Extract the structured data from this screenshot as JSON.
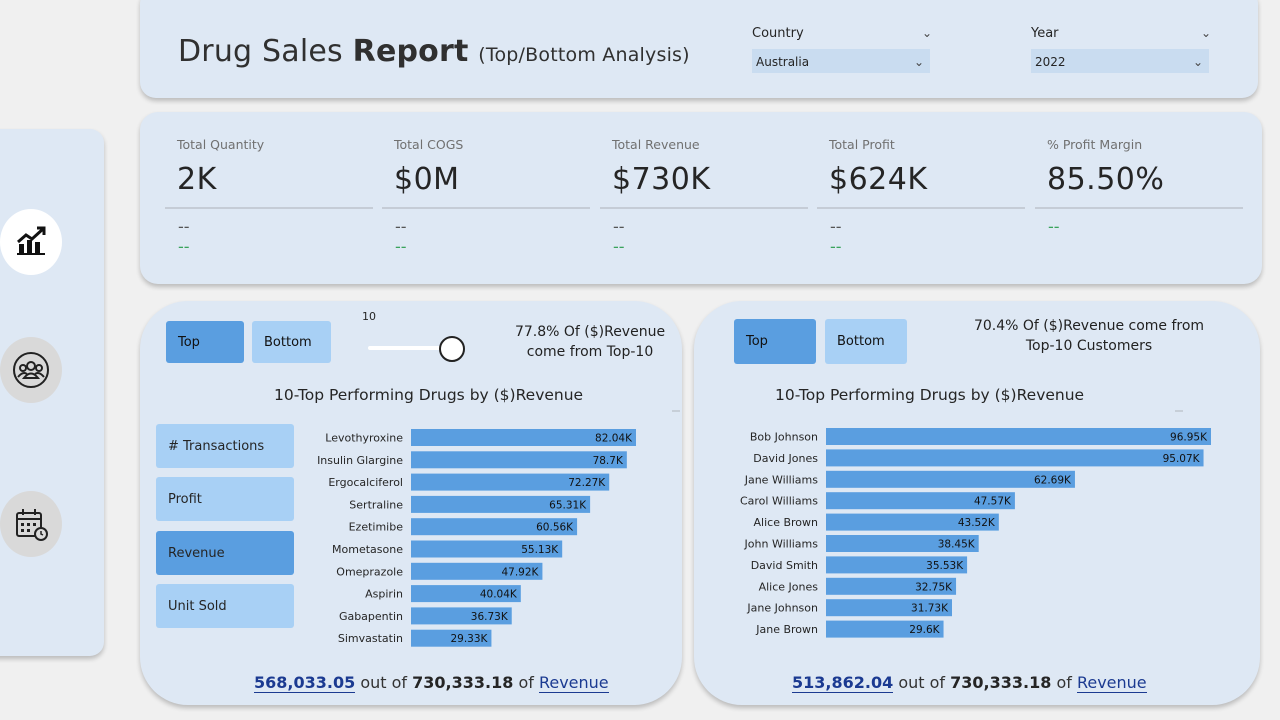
{
  "header": {
    "title_part1": "Drug Sales",
    "title_bold": "Report",
    "title_sub": "(Top/Bottom Analysis)",
    "slicers": [
      {
        "label": "Country",
        "value": "Australia"
      },
      {
        "label": "Year",
        "value": "2022"
      }
    ]
  },
  "kpis": [
    {
      "label": "Total Quantity",
      "value": "2K",
      "dash1": "--",
      "dash2": "--"
    },
    {
      "label": "Total COGS",
      "value": "$0M",
      "dash1": "--",
      "dash2": "--"
    },
    {
      "label": "Total Revenue",
      "value": "$730K",
      "dash1": "--",
      "dash2": "--"
    },
    {
      "label": "Total Profit",
      "value": "$624K",
      "dash1": "--",
      "dash2": "--"
    },
    {
      "label": "% Profit Margin",
      "value": "85.50%",
      "dash1": "",
      "dash2": "--"
    }
  ],
  "nav": {
    "icons": [
      "chart-icon",
      "customers-icon",
      "calendar-icon"
    ]
  },
  "left_panel": {
    "toggle_top": "Top",
    "toggle_bottom": "Bottom",
    "slider_value": "10",
    "note_line1": "77.8% Of ($)Revenue",
    "note_line2": "come from Top-10",
    "chart_title": "10-Top Performing Drugs by ($)Revenue",
    "metrics": [
      "# Transactions",
      "Profit",
      "Revenue",
      "Unit Sold"
    ],
    "active_metric": "Revenue",
    "footer_value": "568,033.05",
    "footer_mid": "out of",
    "footer_total": "730,333.18",
    "footer_of": "of",
    "footer_measure": "Revenue"
  },
  "right_panel": {
    "toggle_top": "Top",
    "toggle_bottom": "Bottom",
    "note_line1": "70.4% Of ($)Revenue come from",
    "note_line2": "Top-10 Customers",
    "chart_title": "10-Top Performing Drugs by ($)Revenue",
    "footer_value": "513,862.04",
    "footer_mid": "out of",
    "footer_total": "730,333.18",
    "footer_of": "of",
    "footer_measure": "Revenue"
  },
  "colors": {
    "bar": "#5a9ee0",
    "panel": "#dee8f4",
    "accent": "#1b3a91",
    "positive": "#3aa35c"
  },
  "chart_data": [
    {
      "type": "bar",
      "orientation": "horizontal",
      "title": "10-Top Performing Drugs by ($)Revenue",
      "categories": [
        "Levothyroxine",
        "Insulin Glargine",
        "Ergocalciferol",
        "Sertraline",
        "Ezetimibe",
        "Mometasone",
        "Omeprazole",
        "Aspirin",
        "Gabapentin",
        "Simvastatin"
      ],
      "values": [
        82040,
        78700,
        72270,
        65310,
        60560,
        55130,
        47920,
        40040,
        36730,
        29330
      ],
      "labels": [
        "82.04K",
        "78.7K",
        "72.27K",
        "65.31K",
        "60.56K",
        "55.13K",
        "47.92K",
        "40.04K",
        "36.73K",
        "29.33K"
      ]
    },
    {
      "type": "bar",
      "orientation": "horizontal",
      "title": "10-Top Performing Drugs by ($)Revenue",
      "categories": [
        "Bob Johnson",
        "David Jones",
        "Jane Williams",
        "Carol Williams",
        "Alice Brown",
        "John Williams",
        "David Smith",
        "Alice Jones",
        "Jane Johnson",
        "Jane Brown"
      ],
      "values": [
        96950,
        95070,
        62690,
        47570,
        43520,
        38450,
        35530,
        32750,
        31730,
        29600
      ],
      "labels": [
        "96.95K",
        "95.07K",
        "62.69K",
        "47.57K",
        "43.52K",
        "38.45K",
        "35.53K",
        "32.75K",
        "31.73K",
        "29.6K"
      ]
    }
  ]
}
